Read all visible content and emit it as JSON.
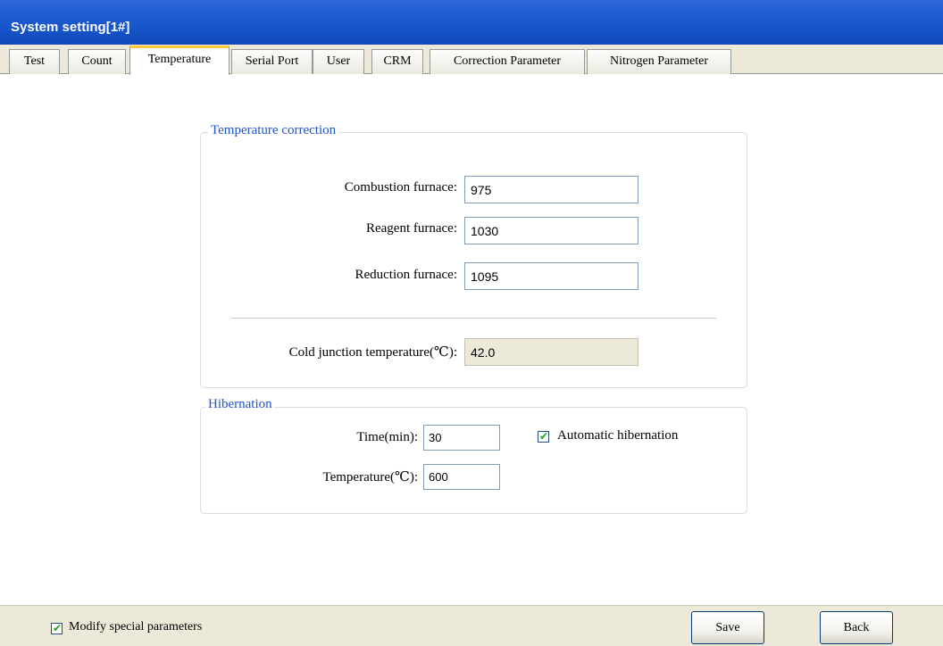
{
  "window": {
    "title": "System setting[1#]"
  },
  "tabs": [
    {
      "label": "Test"
    },
    {
      "label": "Count"
    },
    {
      "label": "Temperature",
      "active": true
    },
    {
      "label": "Serial Port"
    },
    {
      "label": "User"
    },
    {
      "label": "CRM"
    },
    {
      "label": "Correction Parameter"
    },
    {
      "label": "Nitrogen Parameter"
    }
  ],
  "temperature_correction": {
    "legend": "Temperature correction",
    "combustion": {
      "label": "Combustion furnace:",
      "value": "975"
    },
    "reagent": {
      "label": "Reagent furnace:",
      "value": "1030"
    },
    "reduction": {
      "label": "Reduction furnace:",
      "value": "1095"
    },
    "cold_junction": {
      "label": "Cold junction temperature(℃):",
      "value": "42.0"
    }
  },
  "hibernation": {
    "legend": "Hibernation",
    "time": {
      "label": "Time(min):",
      "value": "30"
    },
    "temperature": {
      "label": "Temperature(℃):",
      "value": "600"
    },
    "automatic": {
      "label": "Automatic hibernation",
      "checked": true
    }
  },
  "footer": {
    "modify_special": {
      "label": "Modify special parameters",
      "checked": true
    },
    "save_label": "Save",
    "back_label": "Back"
  },
  "colors": {
    "titlebar": "#1a56cd",
    "legend_text": "#1f54c9",
    "active_tab_accent": "#ffc83c",
    "checkmark": "#21a121"
  }
}
